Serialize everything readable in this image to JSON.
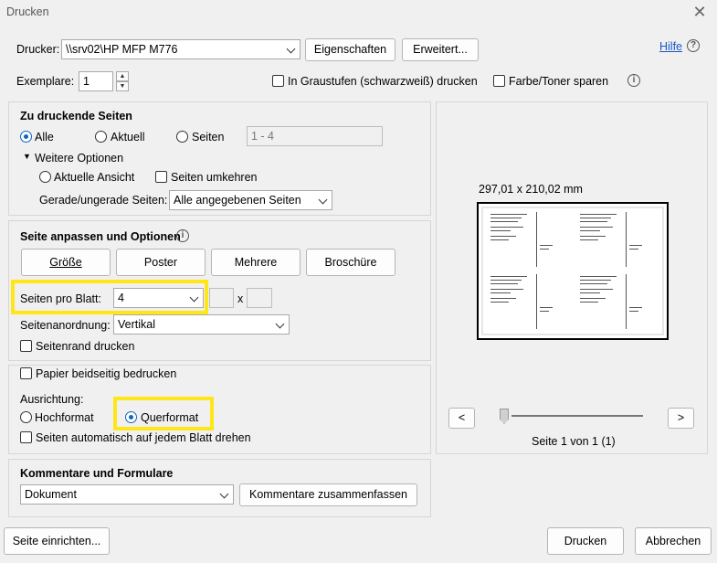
{
  "window": {
    "title": "Drucken",
    "close_symbol": "✕"
  },
  "printer": {
    "label": "Drucker:",
    "value": "\\\\srv02\\HP MFP M776",
    "properties_button": "Eigenschaften",
    "advanced_button": "Erweitert...",
    "help_link": "Hilfe"
  },
  "copies": {
    "label": "Exemplare:",
    "value": "1",
    "grayscale_label": "In Graustufen (schwarzweiß) drucken",
    "save_toner_label": "Farbe/Toner sparen"
  },
  "pages": {
    "title": "Zu druckende Seiten",
    "all_label": "Alle",
    "current_label": "Aktuell",
    "pages_label": "Seiten",
    "pages_range_placeholder": "1 - 4",
    "more_options_label": "Weitere Optionen",
    "current_view_label": "Aktuelle Ansicht",
    "reverse_pages_label": "Seiten umkehren",
    "odd_even_label": "Gerade/ungerade Seiten:",
    "odd_even_value": "Alle angegebenen Seiten"
  },
  "sizing": {
    "title": "Seite anpassen und Optionen",
    "tabs": [
      "Größe",
      "Poster",
      "Mehrere",
      "Broschüre"
    ],
    "pages_per_sheet_label": "Seiten pro Blatt:",
    "pages_per_sheet_value": "4",
    "times_symbol": "x",
    "page_order_label": "Seitenanordnung:",
    "page_order_value": "Vertikal",
    "print_border_label": "Seitenrand drucken"
  },
  "duplex": {
    "both_sides_label": "Papier beidseitig bedrucken",
    "orientation_label": "Ausrichtung:",
    "portrait_label": "Hochformat",
    "landscape_label": "Querformat",
    "auto_rotate_label": "Seiten automatisch auf jedem Blatt drehen"
  },
  "comments": {
    "title": "Kommentare und Formulare",
    "value": "Dokument",
    "summarize_button": "Kommentare zusammenfassen"
  },
  "preview": {
    "dimensions": "297,01 x 210,02 mm",
    "prev_button": "<",
    "next_button": ">",
    "page_status": "Seite 1 von 1 (1)",
    "slider_position": 0
  },
  "footer": {
    "page_setup_button": "Seite einrichten...",
    "print_button": "Drucken",
    "cancel_button": "Abbrechen"
  },
  "colors": {
    "highlight": "#ffe619",
    "accent": "#1065c0",
    "link": "#1a55c8"
  }
}
